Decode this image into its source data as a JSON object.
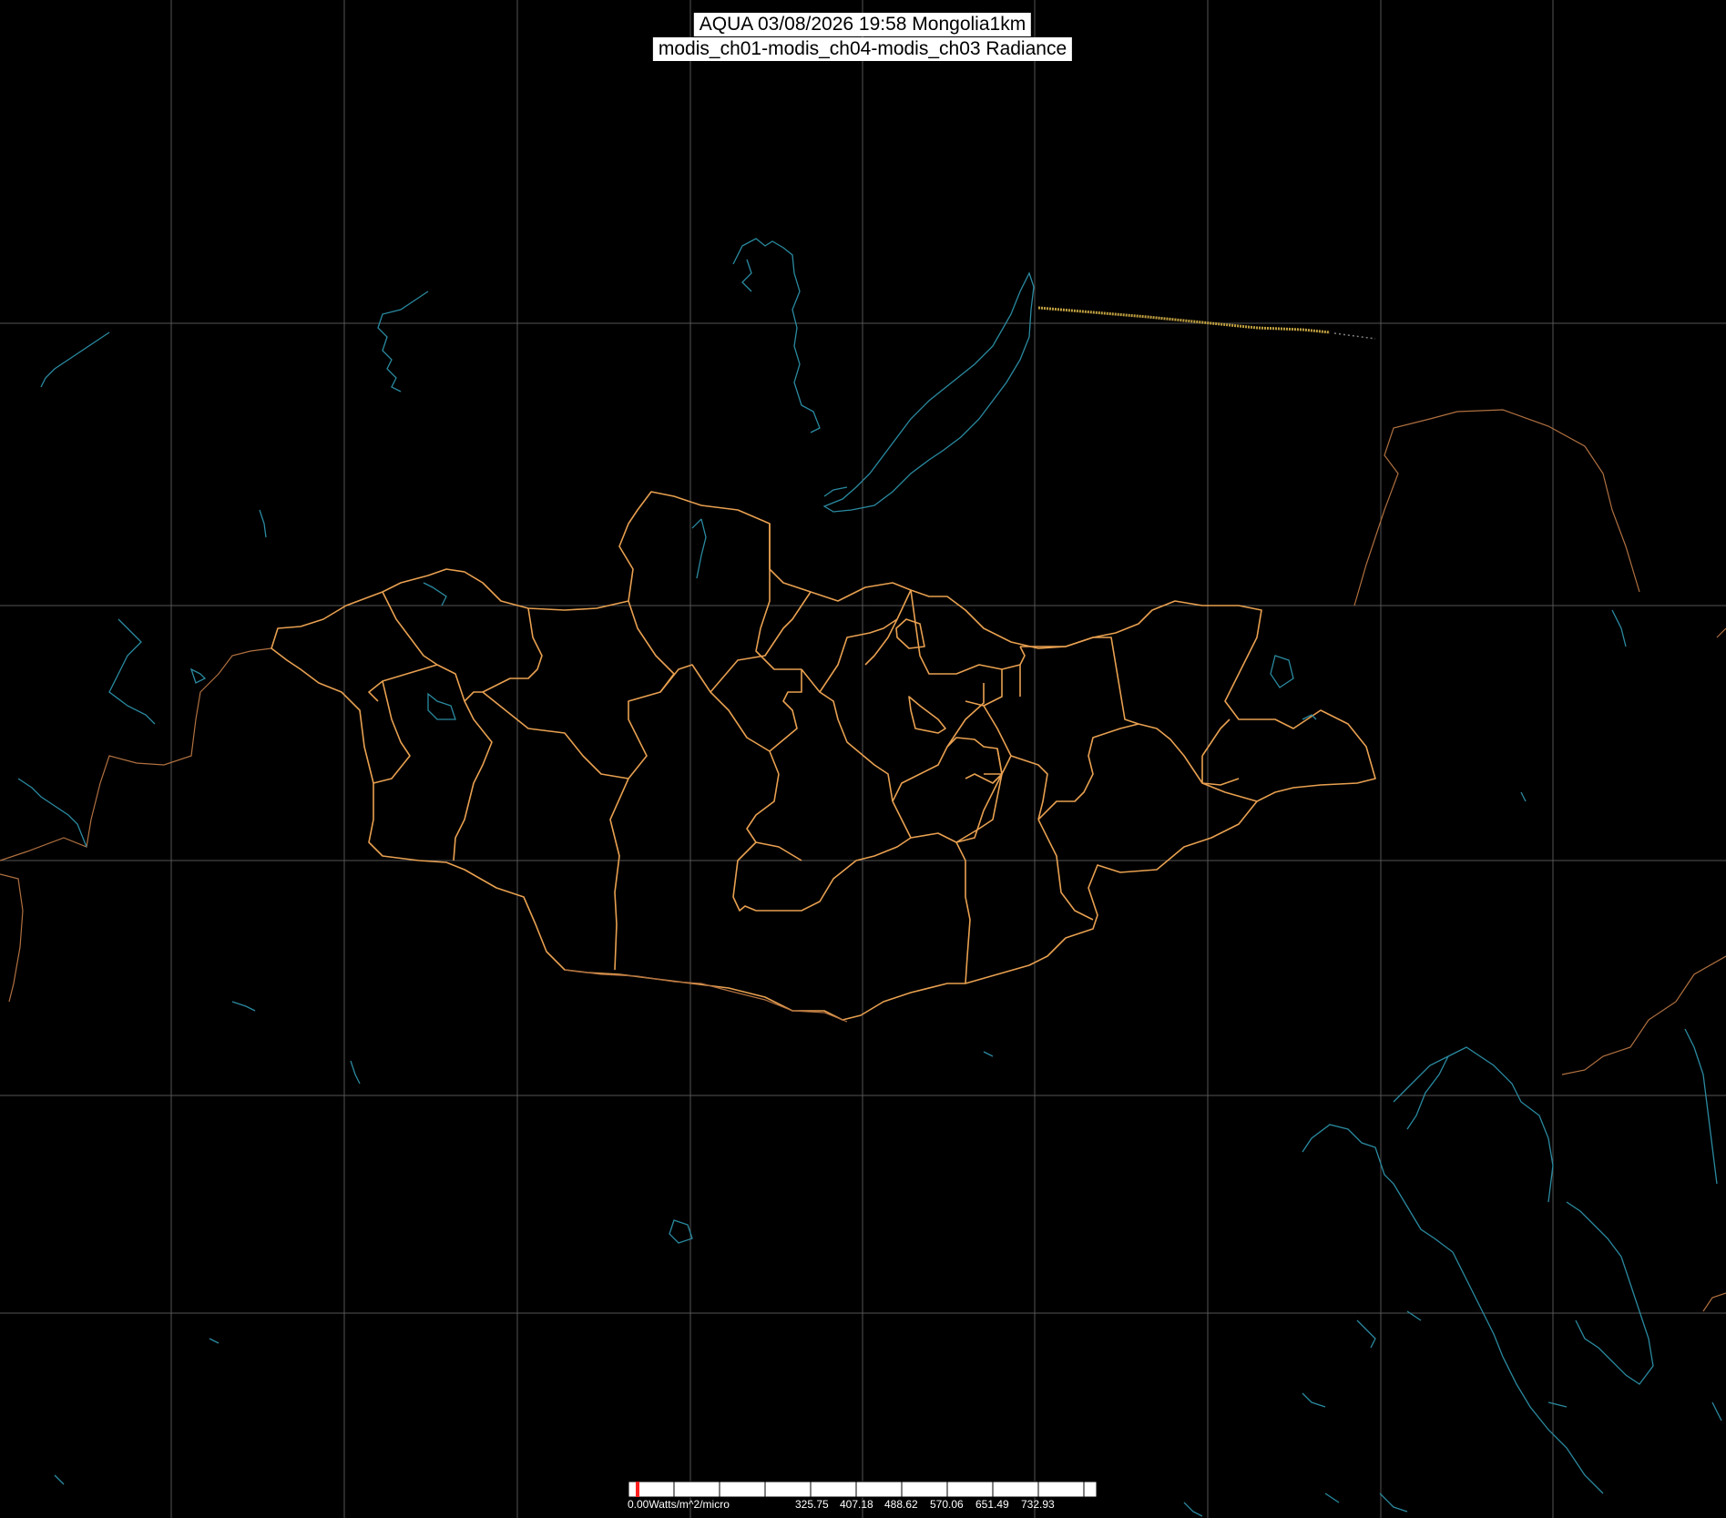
{
  "title": {
    "line1": "AQUA 03/08/2026 19:58 Mongolia1km",
    "line2": "modis_ch01-modis_ch04-modis_ch03 Radiance"
  },
  "legend": {
    "min_label": "0.00Watts/m^2/micro",
    "tick_labels": [
      "325.75",
      "407.18",
      "488.62",
      "570.06",
      "651.49",
      "732.93"
    ],
    "marker_color": "#ff2020"
  },
  "colors": {
    "background": "#000000",
    "graticule": "#555555",
    "province_borders": "#e8a050",
    "country_borders": "#b07040",
    "water": "#2a8aa0",
    "scanline_noise": "#c0a040"
  },
  "map": {
    "region": "Mongolia",
    "graticule": true
  }
}
